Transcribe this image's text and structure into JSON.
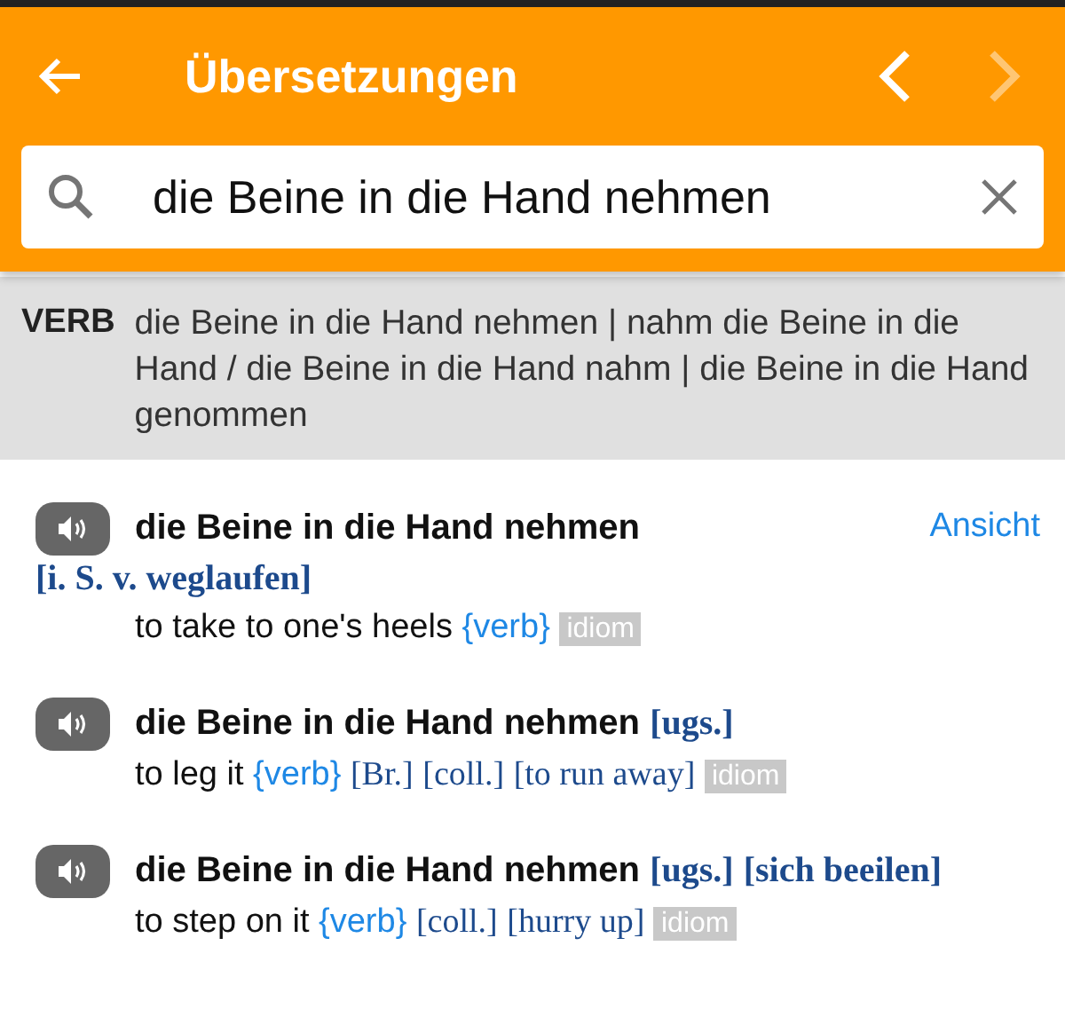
{
  "header": {
    "title": "Übersetzungen",
    "prev": {
      "disabled": false
    },
    "next": {
      "disabled": true
    }
  },
  "search": {
    "value": "die Beine in die Hand nehmen"
  },
  "inflection": {
    "label": "VERB",
    "text": "die Beine in die Hand nehmen | nahm die Beine in die Hand / die Beine in die Hand nahm | die Beine in die Hand genommen"
  },
  "entries": [
    {
      "headword": "die Beine in die Hand nehmen",
      "head_notes": [
        "[i. S. v. weglaufen]"
      ],
      "link": "Ansicht",
      "translation": "to take to one's heels",
      "pos": "{verb}",
      "tag": "idiom"
    },
    {
      "headword": "die Beine in die Hand nehmen",
      "head_notes": [
        "[ugs.]"
      ],
      "translation": "to leg it",
      "pos": "{verb}",
      "notes": [
        "[Br.]",
        "[coll.]",
        "[to run away]"
      ],
      "tag": "idiom"
    },
    {
      "headword": "die Beine in die Hand nehmen",
      "head_notes": [
        "[ugs.]",
        "[sich beeilen]"
      ],
      "translation": "to step on it",
      "pos": "{verb}",
      "notes": [
        "[coll.]",
        "[hurry up]"
      ],
      "tag": "idiom"
    }
  ]
}
